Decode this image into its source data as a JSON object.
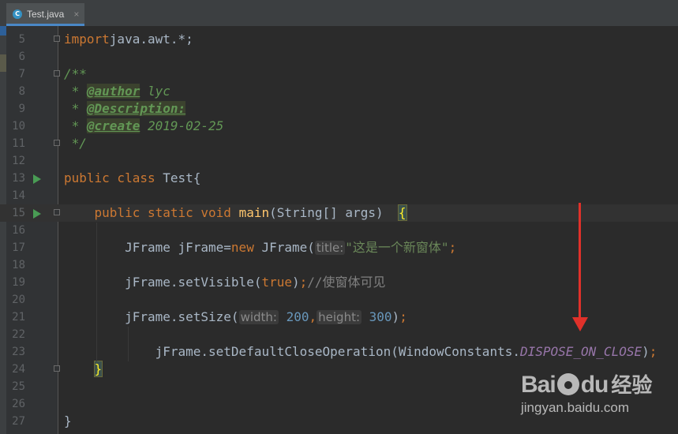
{
  "editor": {
    "tab": {
      "icon": "java-class-icon",
      "icon_letter": "C",
      "label": "Test.java",
      "close": "×"
    }
  },
  "lines": [
    {
      "n": "5",
      "parts": [
        [
          "kw",
          "import"
        ],
        [
          "",
          "java.awt.*;"
        ]
      ]
    },
    {
      "n": "6",
      "parts": []
    },
    {
      "n": "7",
      "parts": [
        [
          "doc",
          "/**"
        ]
      ]
    },
    {
      "n": "8",
      "parts": [
        [
          "doc",
          " * "
        ],
        [
          "tag",
          "@author"
        ],
        [
          "doc",
          " lyc"
        ]
      ]
    },
    {
      "n": "9",
      "parts": [
        [
          "doc",
          " * "
        ],
        [
          "tag",
          "@Description:"
        ]
      ]
    },
    {
      "n": "10",
      "parts": [
        [
          "doc",
          " * "
        ],
        [
          "tag",
          "@create"
        ],
        [
          "doc",
          " 2019-02-25"
        ]
      ]
    },
    {
      "n": "11",
      "parts": [
        [
          "doc",
          " */"
        ]
      ]
    },
    {
      "n": "12",
      "parts": []
    },
    {
      "n": "13",
      "parts": [
        [
          "kw",
          "public class "
        ],
        [
          "",
          "Test{"
        ]
      ]
    },
    {
      "n": "14",
      "parts": []
    },
    {
      "n": "15",
      "parts": [
        [
          "",
          "    "
        ],
        [
          "kw",
          "public static void "
        ],
        [
          "fn",
          "main"
        ],
        [
          "",
          "(String[] args)  "
        ],
        [
          "brace",
          "{"
        ]
      ]
    },
    {
      "n": "16",
      "parts": []
    },
    {
      "n": "17",
      "parts": [
        [
          "",
          "        JFrame jFrame="
        ],
        [
          "kw",
          "new "
        ],
        [
          "",
          "JFrame("
        ],
        [
          "hint",
          "title:"
        ],
        [
          "str",
          "\"这是一个新窗体\""
        ],
        [
          "kw",
          ";"
        ]
      ]
    },
    {
      "n": "18",
      "parts": []
    },
    {
      "n": "19",
      "parts": [
        [
          "",
          "        jFrame.setVisible("
        ],
        [
          "kw",
          "true"
        ],
        [
          "",
          ")"
        ],
        [
          "kw",
          ";"
        ],
        [
          "cm",
          "//使窗体可见"
        ]
      ]
    },
    {
      "n": "20",
      "parts": []
    },
    {
      "n": "21",
      "parts": [
        [
          "",
          "        jFrame.setSize("
        ],
        [
          "hint",
          "width:"
        ],
        [
          "num",
          " 200"
        ],
        [
          "kw",
          ","
        ],
        [
          "hint",
          "height:"
        ],
        [
          "num",
          " 300"
        ],
        [
          "",
          ")"
        ],
        [
          "kw",
          ";"
        ]
      ]
    },
    {
      "n": "22",
      "parts": []
    },
    {
      "n": "23",
      "parts": [
        [
          "",
          "            jFrame.setDefaultCloseOperation(WindowConstants."
        ],
        [
          "const",
          "DISPOSE_ON_CLOSE"
        ],
        [
          "",
          ")"
        ],
        [
          "kw",
          ";"
        ]
      ]
    },
    {
      "n": "24",
      "parts": [
        [
          "",
          "    "
        ],
        [
          "brace",
          "}"
        ]
      ]
    },
    {
      "n": "25",
      "parts": []
    },
    {
      "n": "26",
      "parts": []
    },
    {
      "n": "27",
      "parts": [
        [
          "",
          "}"
        ]
      ]
    }
  ],
  "watermark": {
    "logo": "Bai",
    "logo2": "du",
    "sub": "经验",
    "url": "jingyan.baidu.com"
  }
}
